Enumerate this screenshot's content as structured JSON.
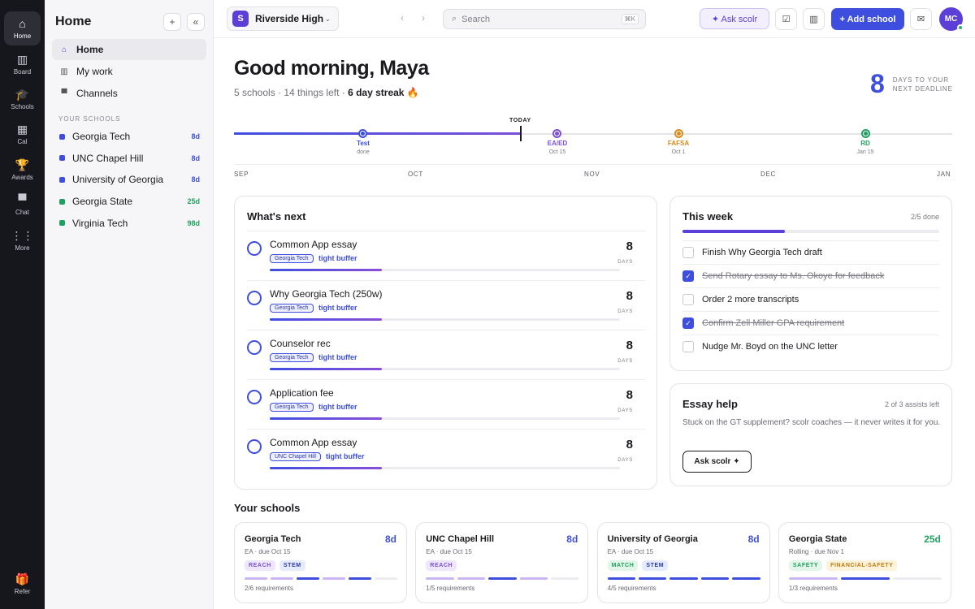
{
  "rail": {
    "items": [
      {
        "label": "Home",
        "icon": "home-icon",
        "glyph": "⌂"
      },
      {
        "label": "Board",
        "icon": "board-icon",
        "glyph": "▥"
      },
      {
        "label": "Schools",
        "icon": "schools-icon",
        "glyph": "🎓"
      },
      {
        "label": "Cal",
        "icon": "calendar-icon",
        "glyph": "▦"
      },
      {
        "label": "Awards",
        "icon": "trophy-icon",
        "glyph": "🏆"
      },
      {
        "label": "Chat",
        "icon": "chat-icon",
        "glyph": "▀"
      },
      {
        "label": "More",
        "icon": "grid-icon",
        "glyph": "⋮⋮"
      }
    ],
    "refer": {
      "label": "Refer",
      "glyph": "🎁"
    }
  },
  "sidebar": {
    "title": "Home",
    "add_glyph": "+",
    "collapse_glyph": "«",
    "nav": [
      {
        "label": "Home",
        "glyph": "⌂"
      },
      {
        "label": "My work",
        "glyph": "▥"
      },
      {
        "label": "Channels",
        "glyph": "▀"
      }
    ],
    "section_label": "YOUR SCHOOLS",
    "schools": [
      {
        "name": "Georgia Tech",
        "days": "8d",
        "color": "#3e4fe0"
      },
      {
        "name": "UNC Chapel Hill",
        "days": "8d",
        "color": "#3e4fe0"
      },
      {
        "name": "University of Georgia",
        "days": "8d",
        "color": "#3e4fe0"
      },
      {
        "name": "Georgia State",
        "days": "25d",
        "color": "#20a060"
      },
      {
        "name": "Virginia Tech",
        "days": "98d",
        "color": "#20a060"
      }
    ]
  },
  "topbar": {
    "workspace": "Riverside High",
    "workspace_logo": "S",
    "search_placeholder": "Search",
    "search_kbd": "⌘K",
    "ask_label": "✦ Ask scolr",
    "add_label": "+ Add school",
    "avatar_initials": "MC"
  },
  "greeting": {
    "title": "Good morning, Maya",
    "summary": "5 schools · 14 things left · ",
    "streak": "6 day streak 🔥",
    "deadline_days": "8",
    "deadline_line1": "DAYS TO YOUR",
    "deadline_line2": "NEXT DEADLINE"
  },
  "timeline": {
    "today_label": "TODAY",
    "progress_fraction": 0.4,
    "months": [
      "SEP",
      "OCT",
      "NOV",
      "DEC",
      "JAN"
    ],
    "milestones": [
      {
        "label": "Test",
        "sub": "done",
        "color": "#3e4fe0"
      },
      {
        "label": "EA/ED",
        "sub": "Oct 15",
        "color": "#7b4fd8"
      },
      {
        "label": "FAFSA",
        "sub": "Oct 1",
        "color": "#d98a1a"
      },
      {
        "label": "RD",
        "sub": "Jan 15",
        "color": "#20a060"
      }
    ]
  },
  "whats_next": {
    "title": "What's next",
    "unit": "DAYS",
    "items": [
      {
        "title": "Common App essay",
        "tag": "Georgia Tech",
        "buffer": "tight buffer",
        "days": "8",
        "progress": 0.32
      },
      {
        "title": "Why Georgia Tech (250w)",
        "tag": "Georgia Tech",
        "buffer": "tight buffer",
        "days": "8",
        "progress": 0.32
      },
      {
        "title": "Counselor rec",
        "tag": "Georgia Tech",
        "buffer": "tight buffer",
        "days": "8",
        "progress": 0.32
      },
      {
        "title": "Application fee",
        "tag": "Georgia Tech",
        "buffer": "tight buffer",
        "days": "8",
        "progress": 0.32
      },
      {
        "title": "Common App essay",
        "tag": "UNC Chapel Hill",
        "buffer": "tight buffer",
        "days": "8",
        "progress": 0.32
      }
    ]
  },
  "this_week": {
    "title": "This week",
    "count": "2/5 done",
    "progress": 0.4,
    "tasks": [
      {
        "text": "Finish Why Georgia Tech draft",
        "done": false
      },
      {
        "text": "Send Rotary essay to Ms. Okoye for feedback",
        "done": true
      },
      {
        "text": "Order 2 more transcripts",
        "done": false
      },
      {
        "text": "Confirm Zell Miller GPA requirement",
        "done": true
      },
      {
        "text": "Nudge Mr. Boyd on the UNC letter",
        "done": false
      }
    ]
  },
  "essay_help": {
    "title": "Essay help",
    "assists": "2 of 3 assists left",
    "text": "Stuck on the GT supplement? scolr coaches — it never writes it for you.",
    "button": "Ask scolr ✦"
  },
  "your_schools": {
    "title": "Your schools",
    "cards": [
      {
        "name": "Georgia Tech",
        "days": "8d",
        "days_color": "#3e4fe0",
        "meta": "EA · due Oct 15",
        "pills": [
          {
            "text": "REACH",
            "bg": "#efe6ff",
            "fg": "#7b4fd8"
          },
          {
            "text": "STEM",
            "bg": "#e6ecff",
            "fg": "#2a36a8"
          }
        ],
        "segments": [
          "#c9b6f3",
          "#c9b6f3",
          "#3e4fe0",
          "#c9b6f3",
          "#3e4fe0",
          "#ececf0"
        ],
        "req": "2/6 requirements"
      },
      {
        "name": "UNC Chapel Hill",
        "days": "8d",
        "days_color": "#3e4fe0",
        "meta": "EA · due Oct 15",
        "pills": [
          {
            "text": "REACH",
            "bg": "#efe6ff",
            "fg": "#7b4fd8"
          }
        ],
        "segments": [
          "#c9b6f3",
          "#c9b6f3",
          "#3e4fe0",
          "#c9b6f3",
          "#ececf0"
        ],
        "req": "1/5 requirements"
      },
      {
        "name": "University of Georgia",
        "days": "8d",
        "days_color": "#3e4fe0",
        "meta": "EA · due Oct 15",
        "pills": [
          {
            "text": "MATCH",
            "bg": "#e3f6ea",
            "fg": "#20a060"
          },
          {
            "text": "STEM",
            "bg": "#e6ecff",
            "fg": "#2a36a8"
          }
        ],
        "segments": [
          "#3e4fe0",
          "#3e4fe0",
          "#3e4fe0",
          "#3e4fe0",
          "#3e4fe0"
        ],
        "req": "4/5 requirements"
      },
      {
        "name": "Georgia State",
        "days": "25d",
        "days_color": "#20a060",
        "meta": "Rolling · due Nov 1",
        "pills": [
          {
            "text": "SAFETY",
            "bg": "#e3f6ea",
            "fg": "#20a060"
          },
          {
            "text": "FINANCIAL-SAFETY",
            "bg": "#fff3dc",
            "fg": "#c07a10"
          }
        ],
        "segments": [
          "#c9b6f3",
          "#3e4fe0",
          "#ececf0"
        ],
        "req": "1/3 requirements"
      }
    ]
  }
}
